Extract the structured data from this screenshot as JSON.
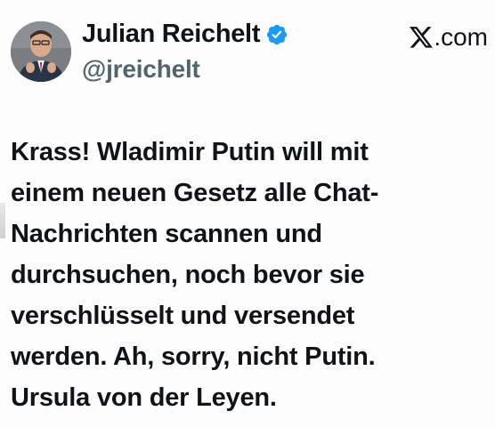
{
  "author": {
    "display_name": "Julian Reichelt",
    "handle": "@jreichelt",
    "verified": true,
    "avatar": "portrait-avatar"
  },
  "source": {
    "domain": ".com",
    "logo": "x-logo-icon"
  },
  "tweet": {
    "lines": [
      "Krass! Wladimir Putin will mit",
      "einem neuen Gesetz alle Chat-",
      "Nachrichten scannen und",
      "durchsuchen, noch bevor sie",
      "verschlüsselt und versendet",
      "werden. Ah, sorry, nicht Putin.",
      "Ursula von der Leyen."
    ]
  },
  "colors": {
    "text": "#0f1419",
    "handle": "#536471",
    "verified": "#1d9bf0"
  }
}
